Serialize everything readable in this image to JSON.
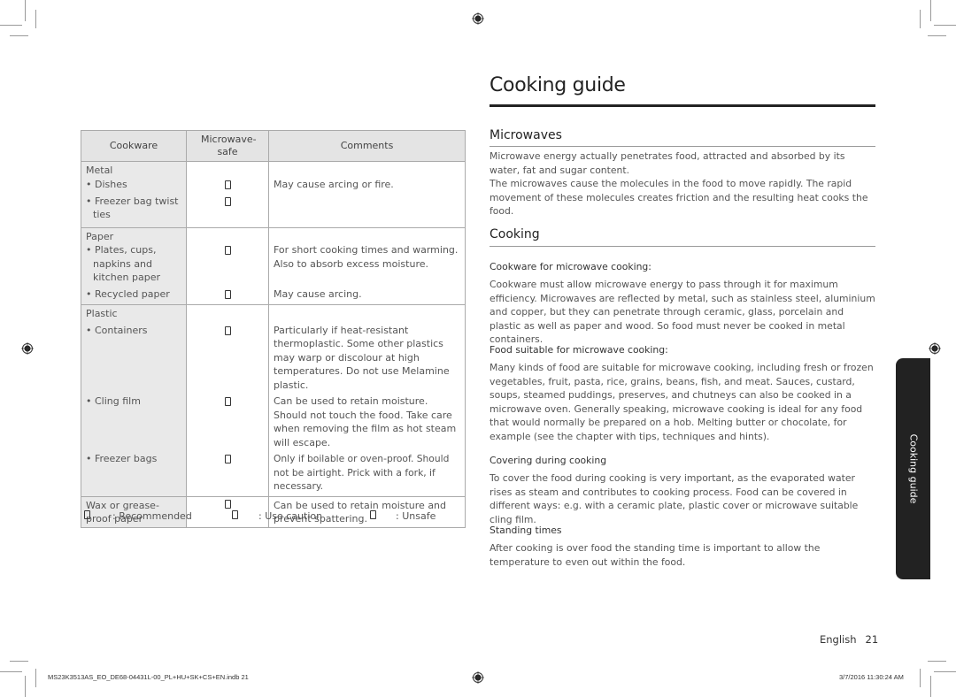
{
  "page": {
    "title": "Cooking guide",
    "side_tab": "Cooking guide",
    "footer": {
      "language": "English",
      "page_number": "21"
    },
    "slug": {
      "file": "MS23K3513AS_EO_DE68-04431L-00_PL+HU+SK+CS+EN.indb   21",
      "timestamp": "3/7/2016   11:30:24 AM"
    }
  },
  "table": {
    "headers": [
      "Cookware",
      "Microwave-safe",
      "Comments"
    ],
    "groups": [
      {
        "category": "Metal",
        "rows": [
          {
            "item": "• Dishes",
            "symbol": "unsafe",
            "comment": "May cause arcing or fire."
          },
          {
            "item": "• Freezer bag twist ties",
            "symbol": "unsafe",
            "comment": ""
          }
        ]
      },
      {
        "category": "Paper",
        "rows": [
          {
            "item": "• Plates, cups, napkins and kitchen paper",
            "symbol": "recommended",
            "comment": "For short cooking times and warming. Also to absorb excess moisture."
          },
          {
            "item": "• Recycled paper",
            "symbol": "caution",
            "comment": "May cause arcing."
          }
        ]
      },
      {
        "category": "Plastic",
        "rows": [
          {
            "item": "• Containers",
            "symbol": "recommended",
            "comment": "Particularly if heat-resistant thermoplastic. Some other plastics may warp or discolour at high temperatures. Do not use Melamine plastic."
          },
          {
            "item": "• Cling film",
            "symbol": "recommended",
            "comment": "Can be used to retain moisture. Should not touch the food. Take care when removing the film as hot steam will escape."
          },
          {
            "item": "• Freezer bags",
            "symbol": "caution",
            "comment": "Only if boilable or oven-proof. Should not be airtight. Prick with a fork, if necessary."
          }
        ]
      },
      {
        "category": "Wax or grease-proof paper",
        "rows": [
          {
            "item": "",
            "symbol": "recommended",
            "comment": "Can be used to retain moisture and prevent spattering."
          }
        ]
      }
    ]
  },
  "legend": [
    {
      "symbol": "recommended",
      "label": ": Recommended"
    },
    {
      "symbol": "caution",
      "label": ": Use caution"
    },
    {
      "symbol": "unsafe",
      "label": ": Unsafe"
    }
  ],
  "sections": {
    "microwaves": {
      "heading": "Microwaves",
      "p1": "Microwave energy actually penetrates food, attracted and absorbed by its water, fat and sugar content.",
      "p2": "The microwaves cause the molecules in the food to move rapidly. The rapid movement of these molecules creates friction and the resulting heat cooks the food."
    },
    "cooking": {
      "heading": "Cooking",
      "cookware_title": "Cookware for microwave cooking:",
      "cookware_text": "Cookware must allow microwave energy to pass through it for maximum efficiency. Microwaves are reflected by metal, such as stainless steel, aluminium and copper, but they can penetrate through ceramic, glass, porcelain and plastic as well as paper and wood. So food must never be cooked in metal containers.",
      "food_title": "Food suitable for microwave cooking:",
      "food_text": "Many kinds of food are suitable for microwave cooking, including fresh or frozen vegetables, fruit, pasta, rice, grains, beans, fish, and meat. Sauces, custard, soups, steamed puddings, preserves, and chutneys can also be cooked in a microwave oven. Generally speaking, microwave cooking is ideal for any food that would normally be prepared on a hob. Melting butter or chocolate, for example (see the chapter with tips, techniques and hints).",
      "covering_title": "Covering during cooking",
      "covering_text": "To cover the food during cooking is very important, as the evaporated water rises as steam and contributes to cooking process. Food can be covered in different ways: e.g. with a ceramic plate, plastic cover or microwave suitable cling film.",
      "standing_title": "Standing times",
      "standing_text": "After cooking is over food the standing time is important to allow the temperature to even out within the food."
    }
  }
}
